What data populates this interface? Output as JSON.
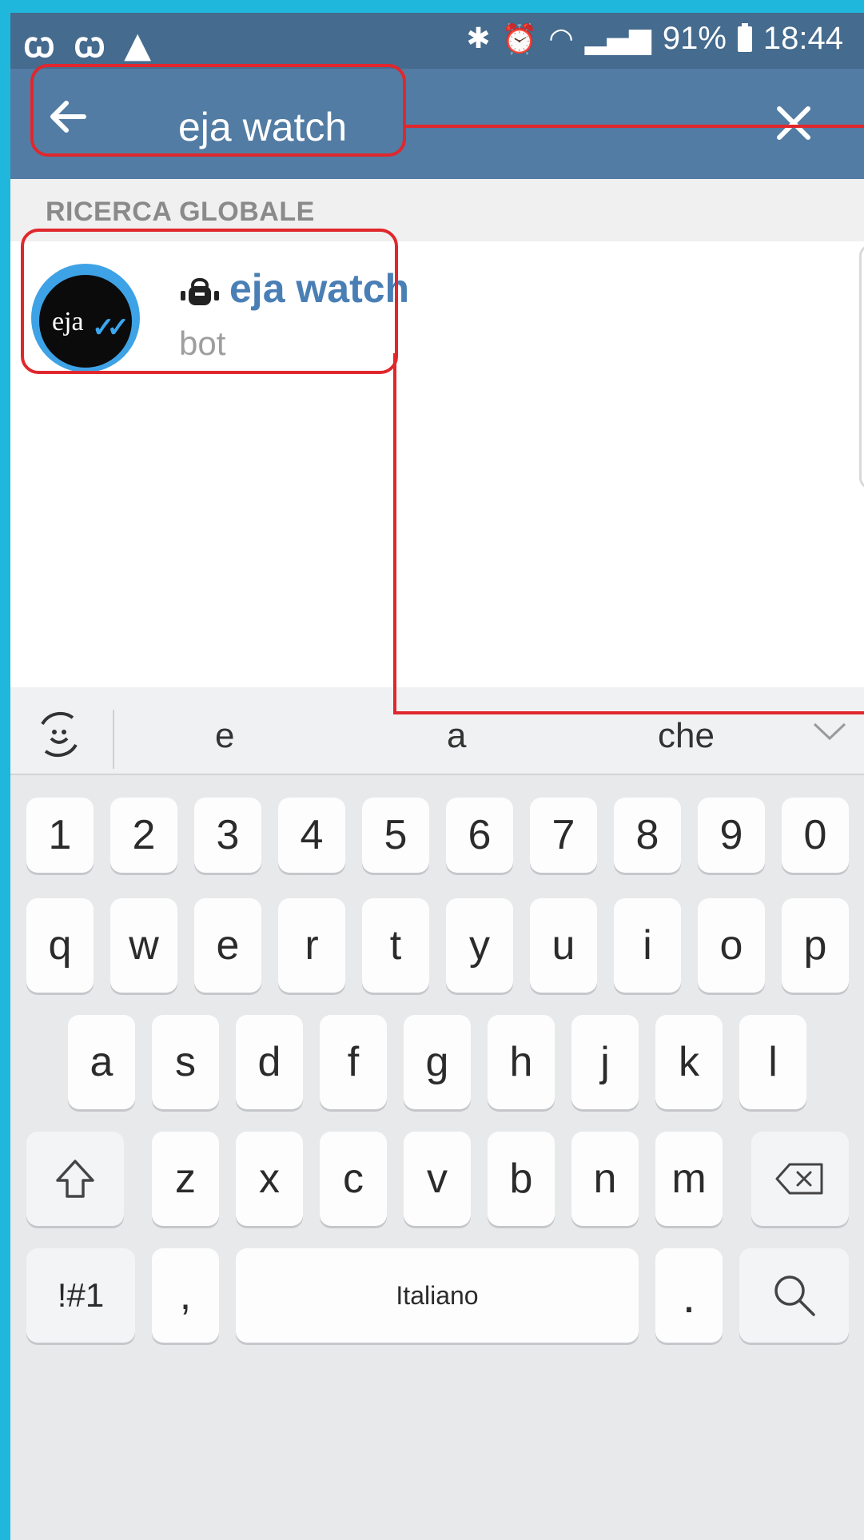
{
  "status_bar": {
    "left_icons": "ꞷ ꞷ ▲",
    "battery_percent": "91%",
    "time": "18:44"
  },
  "search": {
    "query": "eja watch"
  },
  "section": {
    "title": "RICERCA GLOBALE"
  },
  "result": {
    "name": "eja watch",
    "subtitle": "bot",
    "avatar_text": "eja",
    "avatar_check": "✓✓"
  },
  "keyboard": {
    "suggestions": [
      "e",
      "a",
      "che"
    ],
    "row_numbers": [
      "1",
      "2",
      "3",
      "4",
      "5",
      "6",
      "7",
      "8",
      "9",
      "0"
    ],
    "row_q": [
      "q",
      "w",
      "e",
      "r",
      "t",
      "y",
      "u",
      "i",
      "o",
      "p"
    ],
    "row_a": [
      "a",
      "s",
      "d",
      "f",
      "g",
      "h",
      "j",
      "k",
      "l"
    ],
    "row_z": [
      "z",
      "x",
      "c",
      "v",
      "b",
      "n",
      "m"
    ],
    "symbols_key": "!#1",
    "comma_key": ",",
    "space_label": "Italiano",
    "period_key": "."
  },
  "colors": {
    "status_bar": "#456b8e",
    "app_bar": "#527ca3",
    "accent_name": "#4a7fb5",
    "annotation": "#e0272d",
    "frame": "#1fb8dc"
  }
}
